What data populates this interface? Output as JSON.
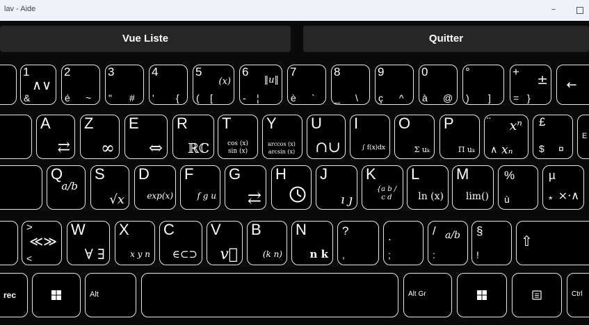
{
  "window": {
    "title": "lav - Aide",
    "minimize": "–"
  },
  "toolbar": {
    "list_view": "Vue Liste",
    "quit": "Quitter"
  },
  "keys": {
    "k1": {
      "top": "1",
      "sym": "∧∨",
      "bot": "&"
    },
    "k2": {
      "top": "2",
      "bot": "é",
      "botr": "~"
    },
    "k3": {
      "top": "3",
      "bot": "\"",
      "botr": "#"
    },
    "k4": {
      "top": "4",
      "bot": "'",
      "botr": "{"
    },
    "k5": {
      "top": "5",
      "sym": "(x)",
      "bot": "(",
      "botr": "["
    },
    "k6": {
      "top": "6",
      "sym": "‖u‖",
      "bot": "-",
      "botr": "¦"
    },
    "k7": {
      "top": "7",
      "bot": "è",
      "botr": "`"
    },
    "k8": {
      "top": "8",
      "bot": "_",
      "botr": "\\"
    },
    "k9": {
      "top": "9",
      "bot": "ç",
      "botr": "^"
    },
    "k0": {
      "top": "0",
      "bot": "à",
      "botr": "@"
    },
    "kdeg": {
      "top": "°",
      "bot": ")",
      "botr": "]"
    },
    "kplus": {
      "top": "+",
      "sym": "±",
      "bot": "=",
      "botr": "}"
    },
    "kback": {
      "sym": "←"
    },
    "kA": {
      "top": "A",
      "sym": "⇄"
    },
    "kZ": {
      "top": "Z",
      "sym": "∞"
    },
    "kE": {
      "top": "E",
      "sym": "⇔"
    },
    "kR": {
      "top": "R",
      "sym": "ℝℂ"
    },
    "kT": {
      "top": "T",
      "sym": "cos (x) sin (x)"
    },
    "kY": {
      "top": "Y",
      "sym": "arccos (x) arcsin (x)"
    },
    "kU": {
      "top": "U",
      "sym": "∩∪"
    },
    "kI": {
      "top": "I",
      "sym": "∫ f(x)dx"
    },
    "kO": {
      "top": "O",
      "sym": "Σ uₖ"
    },
    "kP": {
      "top": "P",
      "sym": "Π uₖ"
    },
    "kxn": {
      "top": "¨",
      "sym": "xⁿ",
      "bot": "∧",
      "botr": "xₙ"
    },
    "kpound": {
      "top": "£",
      "bot": "$",
      "botr": "¤"
    },
    "kenter": {
      "top": "E"
    },
    "kQ": {
      "top": "Q",
      "sym": "a/b"
    },
    "kS": {
      "top": "S",
      "sym": "√x"
    },
    "kD": {
      "top": "D",
      "sym": "exp(x)"
    },
    "kF": {
      "top": "F",
      "sym": "f g u"
    },
    "kG": {
      "top": "G",
      "sym": "⇄"
    },
    "kH": {
      "top": "H",
      "sym": "🕓"
    },
    "kJ": {
      "top": "J",
      "sym": "ı ȷ"
    },
    "kK": {
      "top": "K",
      "sym": "{a b / c d"
    },
    "kL": {
      "top": "L",
      "sym": "ln (x)"
    },
    "kM": {
      "top": "M",
      "sym": "lim()"
    },
    "kpct": {
      "top": "%",
      "bot": "ù"
    },
    "kmu": {
      "top": "µ",
      "bot": "*",
      "sym": "×·∧"
    },
    "klt": {
      "top": ">",
      "sym": "≪≫",
      "bot": "<"
    },
    "kW": {
      "top": "W",
      "sym": "∀ ∃"
    },
    "kX": {
      "top": "X",
      "sym": "x y n"
    },
    "kC": {
      "top": "C",
      "sym": "∈⊂⊃"
    },
    "kV": {
      "top": "V",
      "sym": "v⃗"
    },
    "kB": {
      "top": "B",
      "sym": "(k n)"
    },
    "kN": {
      "top": "N",
      "sym": "n k"
    },
    "kq": {
      "top": "?",
      "bot": ","
    },
    "kdot": {
      "top": ".",
      "bot": ";"
    },
    "kslash": {
      "top": "/",
      "sym": "a/b",
      "bot": ":"
    },
    "ksect": {
      "top": "§",
      "bot": "!"
    },
    "kshift": {
      "sym": "⇧"
    },
    "kctrlL": {
      "label": "rec"
    },
    "kaltL": {
      "label": "Alt"
    },
    "kaltgr": {
      "label": "Alt Gr"
    },
    "kctrlR": {
      "label": "Ctrl"
    }
  }
}
